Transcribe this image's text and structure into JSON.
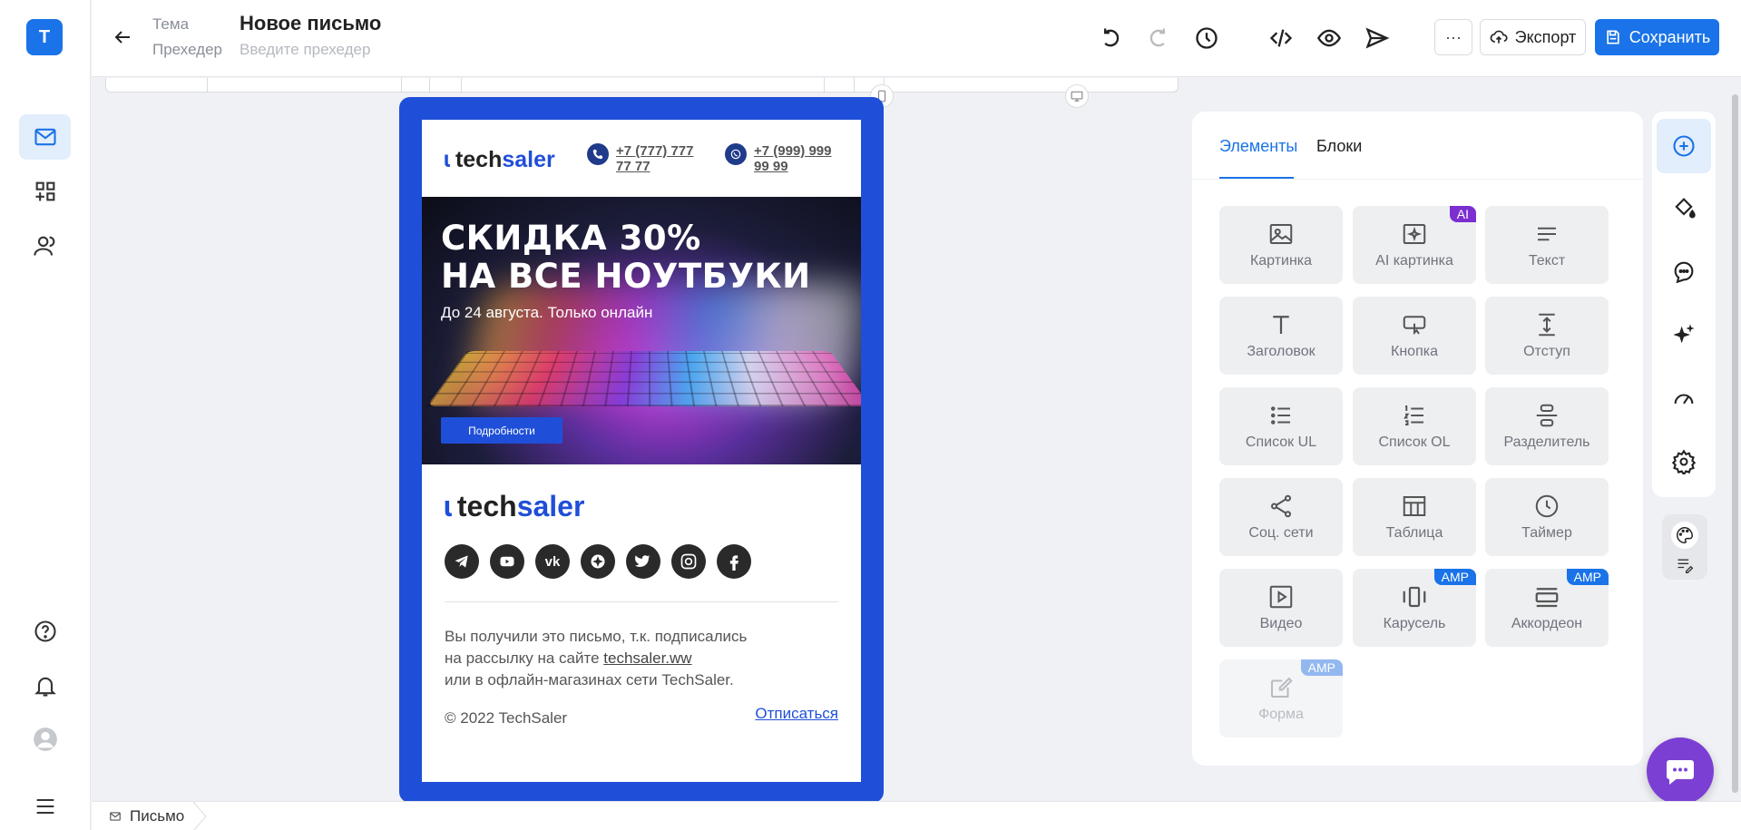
{
  "user": {
    "initial": "Т"
  },
  "header": {
    "topic_label": "Тема",
    "topic_value": "Новое письмо",
    "preheader_label": "Прехедер",
    "preheader_placeholder": "Введите прехедер",
    "more_label": "···",
    "export_label": "Экспорт",
    "save_label": "Сохранить"
  },
  "email": {
    "logo_tech": "tech",
    "logo_saler": "saler",
    "phone1": "+7 (777) 777 77 77",
    "phone2": "+7 (999) 999 99 99",
    "banner_line1": "СКИДКА 30%",
    "banner_line2": "НА ВСЕ НОУТБУКИ",
    "banner_sub": "До 24 августа. Только онлайн",
    "banner_button": "Подробности",
    "footer_line1": "Вы получили это письмо, т.к. подписались",
    "footer_line2_prefix": "на рассылку на сайте ",
    "footer_link": "techsaler.ww",
    "footer_line3": "или в офлайн-магазинах сети TechSaler.",
    "copyright": "© 2022 TechSaler",
    "unsubscribe": "Отписаться",
    "social": [
      "telegram-icon",
      "youtube-icon",
      "vk-icon",
      "odnoklassniki-icon",
      "twitter-icon",
      "instagram-icon",
      "facebook-icon"
    ]
  },
  "panel": {
    "tabs": [
      "Элементы",
      "Блоки"
    ],
    "tiles": [
      {
        "label": "Картинка",
        "icon": "image-icon"
      },
      {
        "label": "AI картинка",
        "icon": "ai-image-icon",
        "badge": "AI"
      },
      {
        "label": "Текст",
        "icon": "text-icon"
      },
      {
        "label": "Заголовок",
        "icon": "heading-icon"
      },
      {
        "label": "Кнопка",
        "icon": "button-icon"
      },
      {
        "label": "Отступ",
        "icon": "spacer-icon"
      },
      {
        "label": "Список UL",
        "icon": "list-ul-icon"
      },
      {
        "label": "Список OL",
        "icon": "list-ol-icon"
      },
      {
        "label": "Разделитель",
        "icon": "divider-icon"
      },
      {
        "label": "Соц. сети",
        "icon": "share-icon"
      },
      {
        "label": "Таблица",
        "icon": "table-icon"
      },
      {
        "label": "Таймер",
        "icon": "timer-icon"
      },
      {
        "label": "Видео",
        "icon": "video-icon"
      },
      {
        "label": "Карусель",
        "icon": "carousel-icon",
        "badge": "AMP"
      },
      {
        "label": "Аккордеон",
        "icon": "accordion-icon",
        "badge": "AMP"
      },
      {
        "label": "Форма",
        "icon": "form-icon",
        "badge": "AMP",
        "disabled": true
      }
    ]
  },
  "footer": {
    "breadcrumb": "Письмо"
  },
  "colors": {
    "accent": "#1a73e8",
    "brand": "#1f4fd8",
    "ai_badge": "#7b2fd0",
    "chat": "#7b3fd4"
  }
}
